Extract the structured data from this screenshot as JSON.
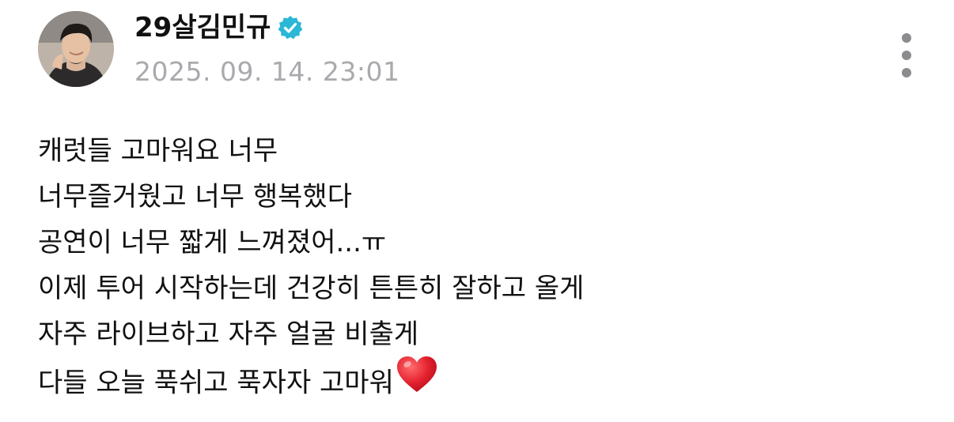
{
  "post": {
    "author": {
      "name": "29살김민규",
      "verified": true,
      "avatar_icon": "avatar-photo"
    },
    "date": "2025. 09. 14. 23:01",
    "more_icon": "vertical-ellipsis-icon",
    "lines": [
      "캐럿들 고마워요 너무",
      "너무즐거웠고 너무 행복했다",
      "공연이 너무 짧게 느껴졌어...ㅠ",
      "이제 투어 시작하는데 건강히 튼튼히 잘하고 올게",
      "자주 라이브하고 자주 얼굴 비출게",
      "다들 오늘 푹쉬고 푹자자 고마워"
    ],
    "trailing_emoji": "red-heart-icon"
  },
  "colors": {
    "badge": "#2bb7d6",
    "date_text": "#a9a9ae",
    "more_dots": "#8b8b90",
    "heart": "#e3202e"
  }
}
